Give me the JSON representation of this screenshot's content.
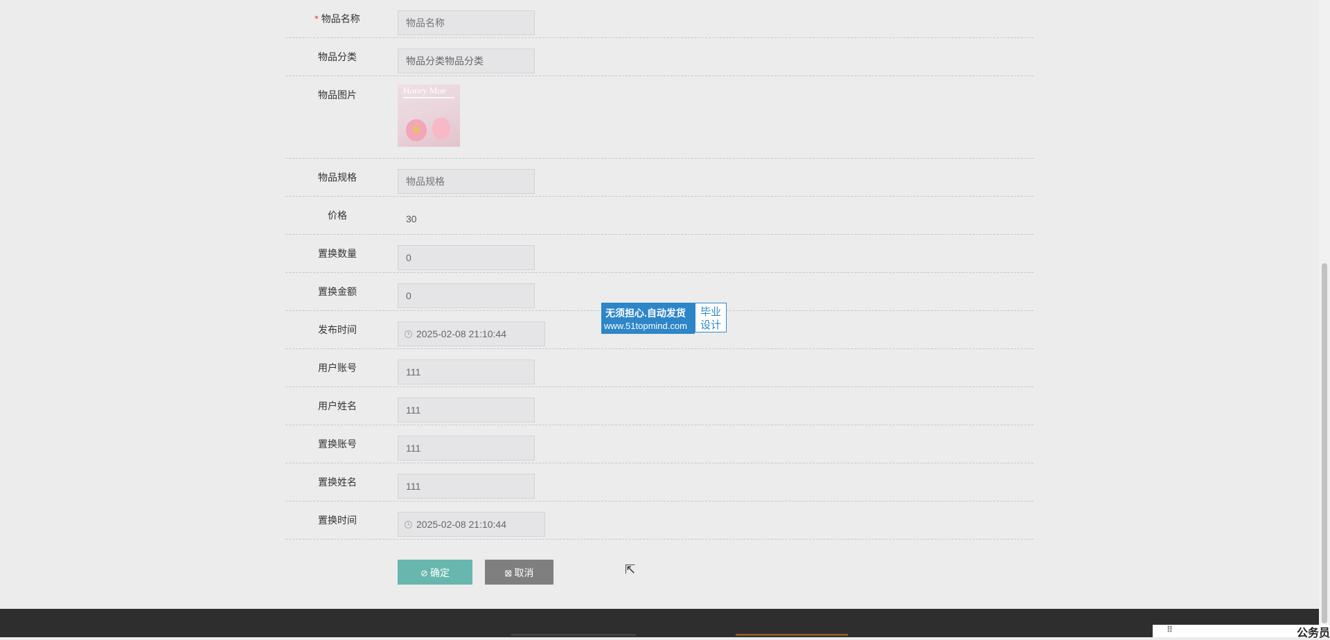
{
  "form": {
    "rows": [
      {
        "label": "物品名称",
        "required": true,
        "placeholder": "物品名称"
      },
      {
        "label": "物品分类",
        "value": "物品分类物品分类"
      },
      {
        "label": "物品图片",
        "image_text": "Honey Moe"
      },
      {
        "label": "物品规格",
        "placeholder": "物品规格"
      },
      {
        "label": "价格",
        "value": "30"
      },
      {
        "label": "置换数量",
        "value": "0"
      },
      {
        "label": "置换金额",
        "value": "0"
      },
      {
        "label": "发布时间",
        "value": "2025-02-08 21:10:44"
      },
      {
        "label": "用户账号",
        "value": "111"
      },
      {
        "label": "用户姓名",
        "value": "111"
      },
      {
        "label": "置换账号",
        "value": "111"
      },
      {
        "label": "置换姓名",
        "value": "111"
      },
      {
        "label": "置换时间",
        "value": "2025-02-08 21:10:44"
      }
    ],
    "required_mark": "*"
  },
  "buttons": {
    "confirm_icon": "⊘",
    "confirm_label": "确定",
    "cancel_icon": "⊠",
    "cancel_label": "取消"
  },
  "watermark": {
    "line1": "无须担心.自动发货",
    "line2": "www.51topmind.com",
    "side_top": "毕业",
    "side_bottom": "设计"
  },
  "corner": {
    "grip": "⠿",
    "text": "公务员"
  },
  "colors": {
    "confirm_button": "#67b7af",
    "cancel_button": "#7f7f7f",
    "footer": "#2e2e2e",
    "badge_blue": "#2d86c8"
  }
}
